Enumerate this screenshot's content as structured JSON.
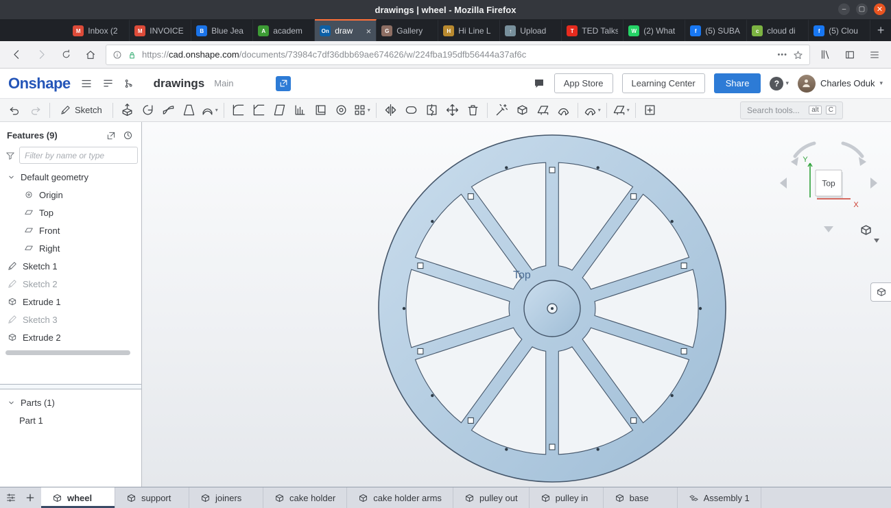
{
  "window": {
    "title": "drawings | wheel - Mozilla Firefox"
  },
  "browser_tabs": [
    {
      "label": "Inbox (2",
      "favicon_bg": "#dd4b39",
      "favicon_glyph": "M"
    },
    {
      "label": "INVOICE",
      "favicon_bg": "#dd4b39",
      "favicon_glyph": "M"
    },
    {
      "label": "Blue Jea",
      "favicon_bg": "#1a73e8",
      "favicon_glyph": "B"
    },
    {
      "label": "academ",
      "favicon_bg": "#3d9b35",
      "favicon_glyph": "A"
    },
    {
      "label": "draw",
      "favicon_bg": "#0c5fa6",
      "favicon_glyph": "On",
      "active": true
    },
    {
      "label": "Gallery",
      "favicon_bg": "#8d6e63",
      "favicon_glyph": "G"
    },
    {
      "label": "Hi Line L",
      "favicon_bg": "#b98a2f",
      "favicon_glyph": "H"
    },
    {
      "label": "Upload",
      "favicon_bg": "#78909c",
      "favicon_glyph": "↑"
    },
    {
      "label": "TED Talks",
      "favicon_bg": "#e62b1e",
      "favicon_glyph": "T"
    },
    {
      "label": "(2) What",
      "favicon_bg": "#25d366",
      "favicon_glyph": "W"
    },
    {
      "label": "(5) SUBA",
      "favicon_bg": "#1877f2",
      "favicon_glyph": "f"
    },
    {
      "label": "cloud di",
      "favicon_bg": "#7cb342",
      "favicon_glyph": "c"
    },
    {
      "label": "(5) Clou",
      "favicon_bg": "#1877f2",
      "favicon_glyph": "f"
    }
  ],
  "navbar": {
    "url_scheme": "https://",
    "url_host": "cad.onshape.com",
    "url_path": "/documents/73984c7df36dbb69ae674626/w/224fba195dfb56444a37af6c"
  },
  "onshape_header": {
    "logo": "Onshape",
    "doc_title": "drawings",
    "workspace": "Main",
    "app_store": "App Store",
    "learning_center": "Learning Center",
    "share": "Share",
    "help": "?",
    "user_name": "Charles Oduk"
  },
  "cad_toolbar": {
    "sketch_label": "Sketch",
    "search_placeholder": "Search tools...",
    "key_alt": "alt",
    "key_c": "C",
    "tools": [
      {
        "tool": "extrude"
      },
      {
        "tool": "revolve"
      },
      {
        "tool": "sweep"
      },
      {
        "tool": "loft"
      },
      {
        "tool": "thicken",
        "dropdown": true
      },
      {
        "divider": true
      },
      {
        "tool": "fillet"
      },
      {
        "tool": "chamfer"
      },
      {
        "tool": "draft"
      },
      {
        "tool": "rib"
      },
      {
        "tool": "shell"
      },
      {
        "tool": "hole"
      },
      {
        "tool": "linear-pattern",
        "dropdown": true
      },
      {
        "divider": true
      },
      {
        "tool": "mirror"
      },
      {
        "tool": "boolean"
      },
      {
        "tool": "split"
      },
      {
        "tool": "transform"
      },
      {
        "tool": "delete-part"
      },
      {
        "divider": true
      },
      {
        "tool": "modify-fillet"
      },
      {
        "tool": "move-face"
      },
      {
        "tool": "replace-face"
      },
      {
        "tool": "offset-surface"
      },
      {
        "divider": true
      },
      {
        "tool": "fillet-surface",
        "dropdown": true
      },
      {
        "divider": true
      },
      {
        "tool": "sheet-metal",
        "dropdown": true
      },
      {
        "divider": true
      },
      {
        "tool": "custom-feature"
      }
    ]
  },
  "features_panel": {
    "title": "Features (9)",
    "filter_placeholder": "Filter by name or type",
    "tree": [
      {
        "label": "Default geometry",
        "type": "group"
      },
      {
        "label": "Origin",
        "type": "origin",
        "indent": 1
      },
      {
        "label": "Top",
        "type": "plane",
        "indent": 1
      },
      {
        "label": "Front",
        "type": "plane",
        "indent": 1
      },
      {
        "label": "Right",
        "type": "plane",
        "indent": 1
      },
      {
        "label": "Sketch 1",
        "type": "sketch"
      },
      {
        "label": "Sketch 2",
        "type": "sketch",
        "disabled": true
      },
      {
        "label": "Extrude 1",
        "type": "extrude"
      },
      {
        "label": "Sketch 3",
        "type": "sketch",
        "disabled": true
      },
      {
        "label": "Extrude 2",
        "type": "extrude"
      }
    ],
    "parts_title": "Parts (1)",
    "parts": [
      "Part 1"
    ]
  },
  "canvas": {
    "plane_label": "Top",
    "model": {
      "part_name": "Part 1",
      "spoke_count": 10,
      "fill_light": "#cadded",
      "fill_dark": "#9fbdd6",
      "edge_color": "#45566a"
    }
  },
  "viewcube": {
    "face_label": "Top",
    "axis_x": "X",
    "axis_y": "Y"
  },
  "document_tabs": [
    {
      "label": "wheel",
      "type": "partstudio",
      "active": true
    },
    {
      "label": "support",
      "type": "partstudio"
    },
    {
      "label": "joiners",
      "type": "partstudio"
    },
    {
      "label": "cake holder",
      "type": "partstudio"
    },
    {
      "label": "cake holder arms",
      "type": "partstudio"
    },
    {
      "label": "pulley out",
      "type": "partstudio"
    },
    {
      "label": "pulley in",
      "type": "partstudio"
    },
    {
      "label": "base",
      "type": "partstudio"
    },
    {
      "label": "Assembly 1",
      "type": "assembly"
    }
  ]
}
